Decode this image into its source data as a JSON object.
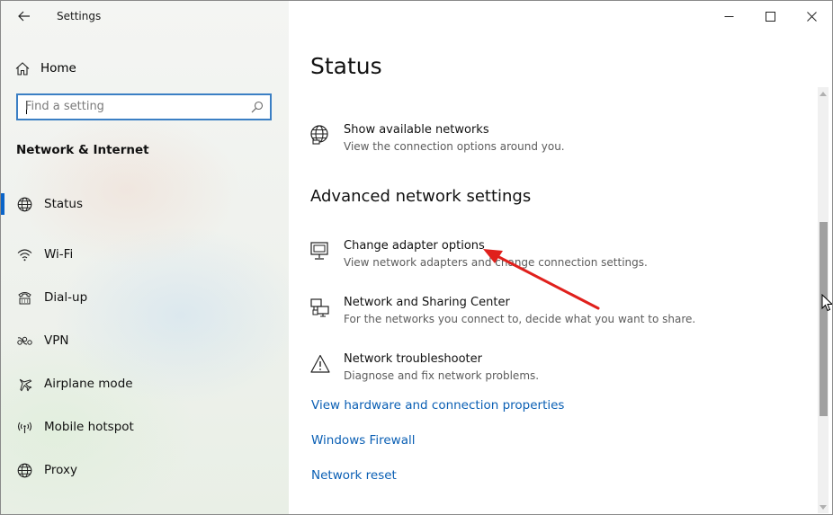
{
  "window": {
    "title": "Settings"
  },
  "sidebar": {
    "home_label": "Home",
    "search_placeholder": "Find a setting",
    "section_title": "Network & Internet",
    "items": [
      {
        "label": "Status",
        "icon": "globe-icon",
        "active": true
      },
      {
        "label": "Wi-Fi",
        "icon": "wifi-icon"
      },
      {
        "label": "Dial-up",
        "icon": "dialup-icon"
      },
      {
        "label": "VPN",
        "icon": "vpn-icon"
      },
      {
        "label": "Airplane mode",
        "icon": "airplane-icon"
      },
      {
        "label": "Mobile hotspot",
        "icon": "hotspot-icon"
      },
      {
        "label": "Proxy",
        "icon": "globe-icon"
      }
    ]
  },
  "main": {
    "title": "Status",
    "show_networks": {
      "title": "Show available networks",
      "desc": "View the connection options around you.",
      "icon": "globe-network-icon"
    },
    "advanced_heading": "Advanced network settings",
    "advanced_items": [
      {
        "title": "Change adapter options",
        "desc": "View network adapters and change connection settings.",
        "icon": "adapter-icon"
      },
      {
        "title": "Network and Sharing Center",
        "desc": "For the networks you connect to, decide what you want to share.",
        "icon": "sharing-center-icon"
      },
      {
        "title": "Network troubleshooter",
        "desc": "Diagnose and fix network problems.",
        "icon": "warning-icon"
      }
    ],
    "links": [
      "View hardware and connection properties",
      "Windows Firewall",
      "Network reset"
    ]
  },
  "colors": {
    "accent": "#0a64c8",
    "link": "#0a5fb4",
    "annotation_arrow": "#e0201c"
  }
}
